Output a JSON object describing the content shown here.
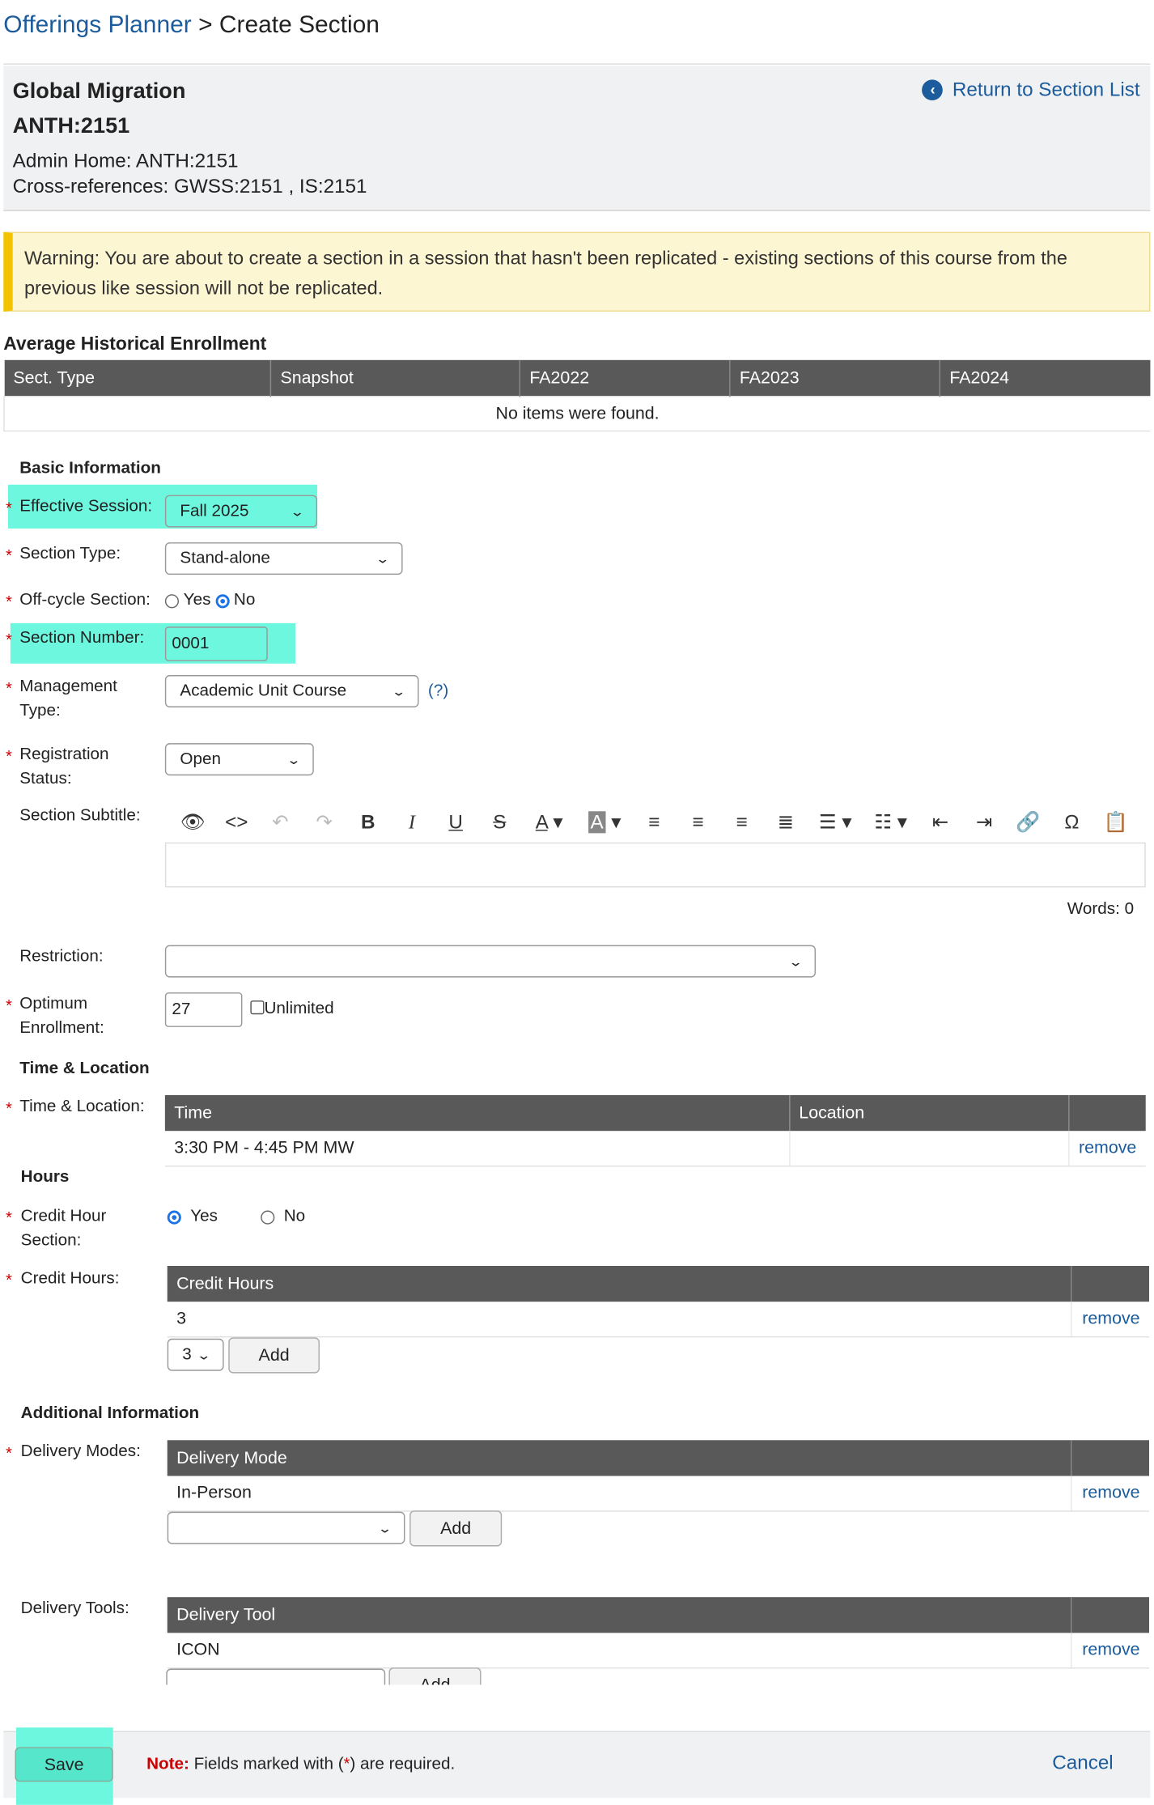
{
  "breadcrumb": {
    "link": "Offerings Planner",
    "separator": ">",
    "current": "Create Section"
  },
  "course": {
    "title": "Global Migration",
    "code": "ANTH:2151",
    "admin_home": "Admin Home: ANTH:2151",
    "cross_refs": "Cross-references: GWSS:2151 , IS:2151",
    "return_link": "Return to Section List",
    "return_icon": "chevron-left-circle-icon"
  },
  "warning": "Warning: You are about to create a section in a session that hasn't been replicated - existing sections of this course from the previous like session will not be replicated.",
  "avg_enrollment": {
    "heading": "Average Historical Enrollment",
    "columns": [
      "Sect. Type",
      "Snapshot",
      "FA2022",
      "FA2023",
      "FA2024"
    ],
    "empty": "No items were found."
  },
  "basic": {
    "heading": "Basic Information",
    "effective_session": {
      "label": "Effective Session:",
      "value": "Fall 2025"
    },
    "section_type": {
      "label": "Section Type:",
      "value": "Stand-alone"
    },
    "off_cycle": {
      "label": "Off-cycle Section:",
      "yes": "Yes",
      "no": "No",
      "selected": "No"
    },
    "section_number": {
      "label": "Section Number:",
      "value": "0001"
    },
    "management_type": {
      "label_1": "Management",
      "label_2": "Type:",
      "value": "Academic Unit Course",
      "help": "(?)"
    },
    "registration_status": {
      "label_1": "Registration",
      "label_2": "Status:",
      "value": "Open"
    },
    "section_subtitle": {
      "label": "Section Subtitle:"
    },
    "editor": {
      "words": "Words: 0",
      "tools": [
        "preview-icon",
        "source-code-icon",
        "undo-icon",
        "redo-icon",
        "bold-icon",
        "italic-icon",
        "underline-icon",
        "strikethrough-icon",
        "font-color-icon",
        "highlight-color-icon",
        "align-left-icon",
        "align-center-icon",
        "align-right-icon",
        "justify-icon",
        "bullet-list-icon",
        "numbered-list-icon",
        "outdent-icon",
        "indent-icon",
        "link-icon",
        "special-char-icon",
        "paste-icon"
      ]
    },
    "restriction": {
      "label": "Restriction:",
      "value": ""
    },
    "optimum_enrollment": {
      "label_1": "Optimum",
      "label_2": "Enrollment:",
      "value": "27",
      "unlimited": "Unlimited"
    }
  },
  "time_location": {
    "heading": "Time & Location",
    "label": "Time & Location:",
    "columns": [
      "Time",
      "Location"
    ],
    "rows": [
      {
        "time": "3:30 PM - 4:45 PM MW",
        "location": "",
        "action": "remove"
      }
    ]
  },
  "hours": {
    "heading": "Hours",
    "credit_hour_section": {
      "label_1": "Credit Hour",
      "label_2": "Section:",
      "yes": "Yes",
      "no": "No",
      "selected": "Yes"
    },
    "credit_hours": {
      "label": "Credit Hours:",
      "column": "Credit Hours",
      "rows": [
        {
          "value": "3",
          "action": "remove"
        }
      ],
      "select_value": "3",
      "add": "Add"
    }
  },
  "additional": {
    "heading": "Additional Information",
    "delivery_modes": {
      "label": "Delivery Modes:",
      "column": "Delivery Mode",
      "rows": [
        {
          "value": "In-Person",
          "action": "remove"
        }
      ],
      "select_value": "",
      "add": "Add"
    },
    "delivery_tools": {
      "label": "Delivery Tools:",
      "column": "Delivery Tool",
      "rows": [
        {
          "value": "ICON",
          "action": "remove"
        }
      ],
      "select_value": "",
      "add": "Add"
    }
  },
  "footer": {
    "save": "Save",
    "note_label": "Note:",
    "note_text_1": "Fields marked with (",
    "note_star": "*",
    "note_text_2": ") are required.",
    "cancel": "Cancel"
  },
  "required_mark": "*",
  "colors": {
    "link": "#1c5c9c",
    "header": "#595959",
    "highlight": "#6df7de",
    "warning_bar": "#f3c300",
    "required": "#cc0000"
  }
}
